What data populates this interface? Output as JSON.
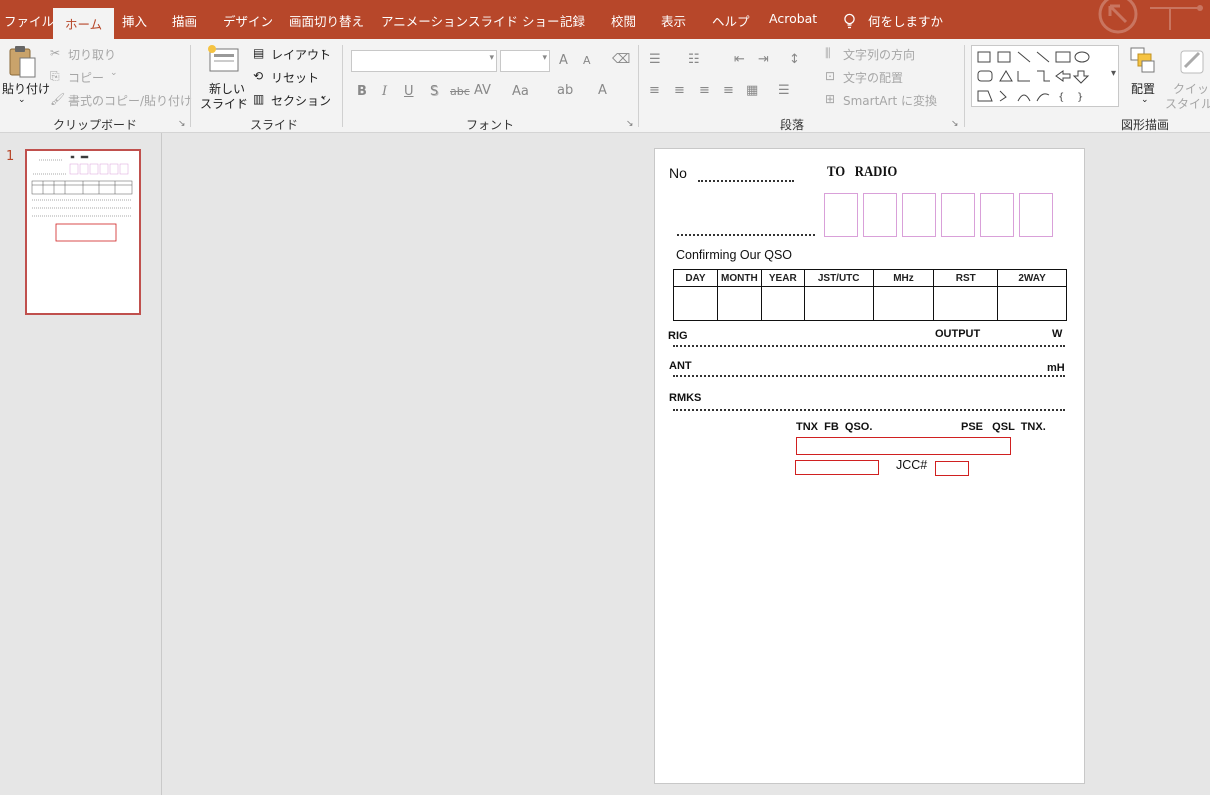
{
  "menu": {
    "items": [
      "ファイル",
      "ホーム",
      "挿入",
      "描画",
      "デザイン",
      "画面切り替え",
      "アニメーション",
      "スライド ショー",
      "記録",
      "校閲",
      "表示",
      "ヘルプ",
      "Acrobat"
    ],
    "tell_me": "何をしますか",
    "active": "ホーム"
  },
  "ribbon": {
    "clipboard": {
      "paste": "貼り付け",
      "cut": "切り取り",
      "copy": "コピー",
      "format_painter": "書式のコピー/貼り付け",
      "label": "クリップボード"
    },
    "slides": {
      "new_slide_1": "新しい",
      "new_slide_2": "スライド",
      "layout": "レイアウト",
      "reset": "リセット",
      "section": "セクション",
      "label": "スライド"
    },
    "font": {
      "label": "フォント",
      "bold": "B",
      "italic": "I",
      "underline": "U",
      "shadow": "S",
      "strike": "abc",
      "spacing": "AV",
      "case": "Aa",
      "grow": "A",
      "shrink": "A",
      "color": "A"
    },
    "paragraph": {
      "label": "段落",
      "text_direction": "文字列の方向",
      "align_text": "文字の配置",
      "smartart": "SmartArt に変換"
    },
    "drawing": {
      "label": "図形描画",
      "arrange": "配置",
      "quick_styles_1": "クイック",
      "quick_styles_2": "スタイル"
    }
  },
  "thumbnails": [
    {
      "number": "1"
    }
  ],
  "slide": {
    "no_label": "No",
    "title": "TO   RADIO",
    "confirming": "Confirming Our QSO",
    "table_headers": [
      "DAY",
      "MONTH",
      "YEAR",
      "JST/UTC",
      "MHz",
      "RST",
      "2WAY"
    ],
    "rig": "RIG",
    "output": "OUTPUT",
    "watt": "W",
    "ant": "ANT",
    "mh": "mH",
    "rmks": "RMKS",
    "tnx_fb": "TNX  FB  QSO.",
    "pse_qsl": "PSE   QSL  TNX.",
    "jcc": "JCC#"
  }
}
